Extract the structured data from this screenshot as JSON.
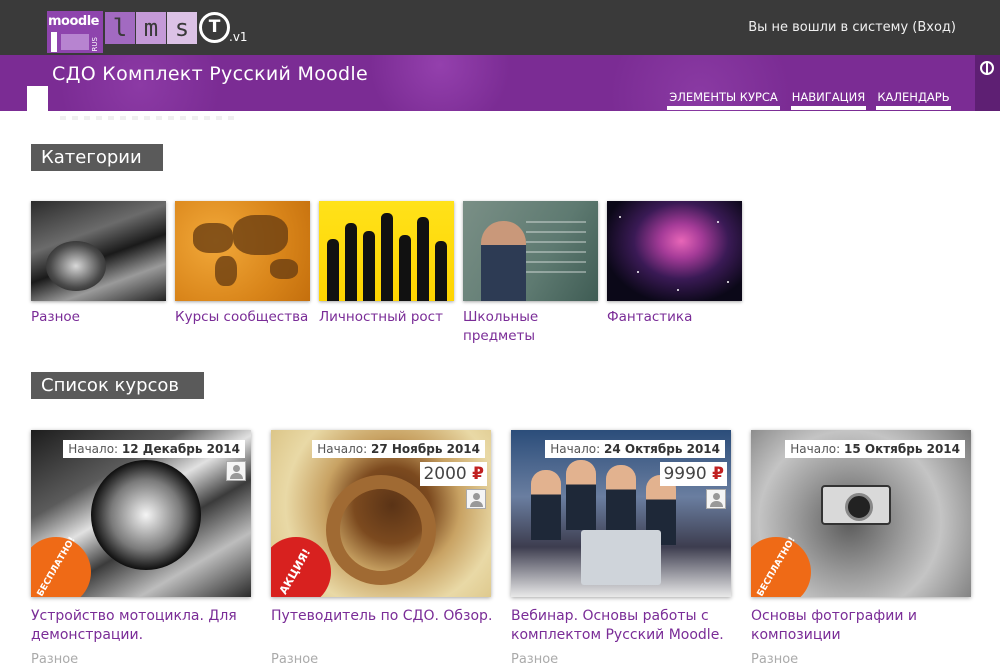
{
  "header": {
    "logo_moodle": "moodle",
    "logo_rus": "RUS",
    "logo_lms": [
      "l",
      "m",
      "s"
    ],
    "logo_t": "T",
    "logo_version": ".v1",
    "login_text": "Вы не вошли в систему (Вход)",
    "site_title": "СДО Комплект Русский Moodle",
    "nav": [
      "ЭЛЕМЕНТЫ КУРСА",
      "НАВИГАЦИЯ",
      "КАЛЕНДАРЬ"
    ]
  },
  "categories": {
    "heading": "Категории",
    "items": [
      {
        "label": "Разное"
      },
      {
        "label": "Курсы сообщества"
      },
      {
        "label": "Личностный рост"
      },
      {
        "label": "Школьные предметы"
      },
      {
        "label": "Фантастика"
      }
    ]
  },
  "courses": {
    "heading": "Список курсов",
    "start_label": "Начало:",
    "items": [
      {
        "date": "12 Декабрь 2014",
        "price": "",
        "sticker": "БЕСПЛАТНО!",
        "title": "Устройство мотоцикла. Для демонстрации.",
        "category": "Разное"
      },
      {
        "date": "27 Ноябрь 2014",
        "price": "2000",
        "sticker": "АКЦИЯ!",
        "title": "Путеводитель по СДО. Обзор.",
        "category": "Разное"
      },
      {
        "date": "24 Октябрь 2014",
        "price": "9990",
        "sticker": "",
        "title": "Вебинар. Основы работы с комплектом Русский Moodle.",
        "category": "Разное"
      },
      {
        "date": "15 Октябрь 2014",
        "price": "",
        "sticker": "БЕСПЛАТНО!",
        "title": "Основы фотографии и композиции",
        "category": "Разное"
      }
    ],
    "currency": "₽"
  },
  "icons": {
    "globe": "globe-icon",
    "avatar": "user-avatar-icon"
  },
  "colors": {
    "topbar": "#3a3a3a",
    "banner": "#7b2c94",
    "link": "#7a2c97",
    "heading_bg": "#5a5a5a",
    "free_sticker": "#ef6a16",
    "sale_sticker": "#d8211f"
  }
}
